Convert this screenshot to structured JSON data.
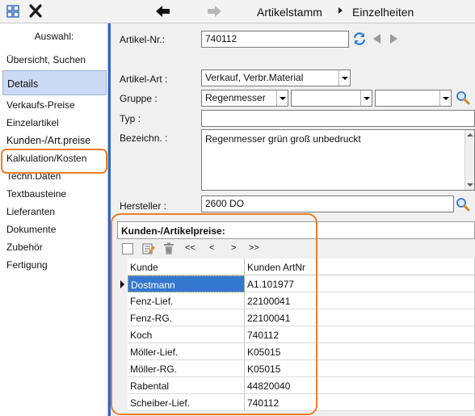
{
  "toolbar": {
    "title": "Artikelstamm",
    "subtitle": "Einzelheiten",
    "icons": [
      "grid-icon",
      "close-icon",
      "back-arrow-icon",
      "forward-arrow-icon"
    ],
    "accent_color": "#2b66c8"
  },
  "sidebar": {
    "header": "Auswahl:",
    "overview": "Übersicht, Suchen",
    "details": "Details",
    "items": [
      {
        "label": "Verkaufs-Preise"
      },
      {
        "label": "Einzelartikel"
      },
      {
        "label": "Kunden-/Art.preise"
      },
      {
        "label": "Kalkulation/Kosten"
      },
      {
        "label": "Techn.Daten"
      },
      {
        "label": "Textbausteine"
      },
      {
        "label": "Lieferanten"
      },
      {
        "label": "Dokumente"
      },
      {
        "label": "Zubehör"
      },
      {
        "label": "Fertigung"
      }
    ],
    "active_item": "Kunden-/Art.preise",
    "highlight_color": "#ee7d2a"
  },
  "form": {
    "artnr_label": "Artikel-Nr.:",
    "artnr_value": "740112",
    "artart_label": "Artikel-Art :",
    "artart_value": "Verkauf, Verbr.Material",
    "gruppe_label": "Gruppe :",
    "gruppe1_value": "Regenmesser",
    "gruppe2_value": "",
    "gruppe3_value": "",
    "typ_label": "Typ :",
    "typ_value": "",
    "bez_label": "Bezeichn. :",
    "bez_value": "Regenmesser grün groß unbedruckt",
    "hersteller_label": "Hersteller :",
    "hersteller_value": "2600 DO"
  },
  "prices": {
    "title": "Kunden-/Artikelpreise:",
    "nav": {
      "first": "<<",
      "prev": "<",
      "next": ">",
      "last": ">>"
    },
    "columns": [
      "Kunde",
      "Kunden ArtNr"
    ],
    "rows": [
      {
        "kunde": "Dostmann",
        "artnr": "A1.101977"
      },
      {
        "kunde": "Fenz-Lief.",
        "artnr": "22100041"
      },
      {
        "kunde": "Fenz-RG.",
        "artnr": "22100041"
      },
      {
        "kunde": "Koch",
        "artnr": "740112"
      },
      {
        "kunde": "Möller-Lief.",
        "artnr": "K05015"
      },
      {
        "kunde": "Möller-RG.",
        "artnr": "K05015"
      },
      {
        "kunde": "Rabental",
        "artnr": "44820040"
      },
      {
        "kunde": "Scheiber-Lief.",
        "artnr": "740112"
      }
    ],
    "selected_row": 0,
    "selection_color": "#3478d0"
  }
}
